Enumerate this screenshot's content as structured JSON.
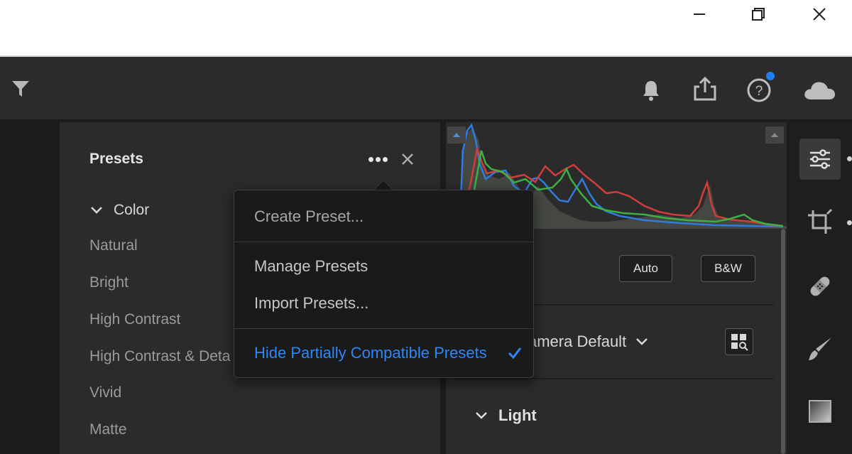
{
  "window": {
    "controls": [
      "minimize-icon",
      "restore-icon",
      "close-icon"
    ]
  },
  "toolbar": {
    "icons": [
      "filter-icon",
      "bell-icon",
      "share-icon",
      "help-icon",
      "cloud-icon"
    ],
    "notification_color": "#1e7ff2"
  },
  "presets_panel": {
    "title": "Presets",
    "group": "Color",
    "items": [
      "Natural",
      "Bright",
      "High Contrast",
      "High Contrast & Deta",
      "Vivid",
      "Matte"
    ]
  },
  "menu": {
    "items": [
      "Create Preset...",
      "Manage Presets",
      "Import Presets...",
      "Hide Partially Compatible Presets"
    ],
    "checked_item": "Hide Partially Compatible Presets",
    "accent": "#2f86f5"
  },
  "edit_panel": {
    "auto_label": "Auto",
    "bw_label": "B&W",
    "profile": "amera Default",
    "section": "Light"
  },
  "tools": [
    "edit-sliders-icon",
    "crop-icon",
    "healing-icon",
    "brush-icon",
    "gradient-icon"
  ]
}
